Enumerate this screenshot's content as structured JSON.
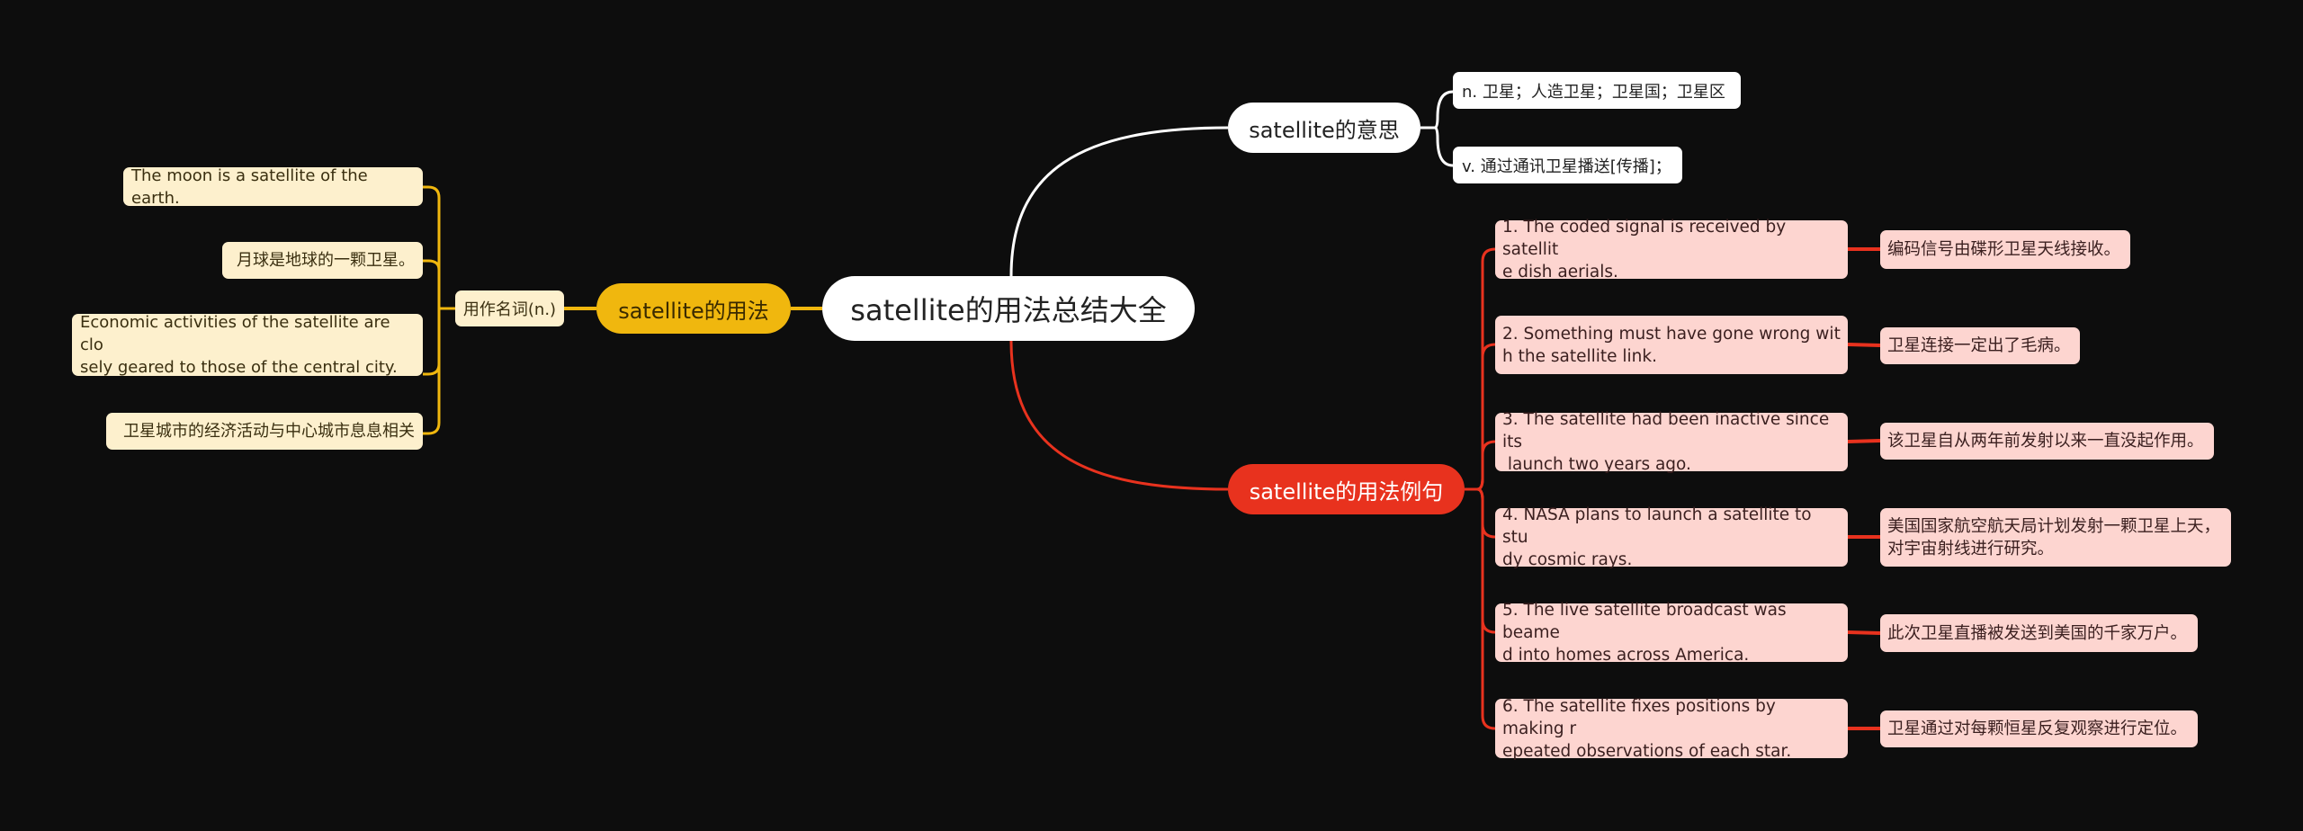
{
  "root": {
    "label": "satellite的用法总结大全"
  },
  "branches": {
    "usage": {
      "label": "satellite的用法",
      "color": "#f0b70e",
      "category": {
        "label": "用作名词(n.)"
      },
      "examples": [
        "The moon is a satellite of the earth.",
        "月球是地球的一颗卫星。",
        "Economic activities of the satellite are clo\nsely geared to those of the central city.",
        "卫星城市的经济活动与中心城市息息相关"
      ]
    },
    "meaning": {
      "label": "satellite的意思",
      "color": "#ffffff",
      "items": [
        "n. 卫星；人造卫星；卫星国；卫星区",
        "v. 通过通讯卫星播送[传播]；"
      ]
    },
    "sentences": {
      "label": "satellite的用法例句",
      "color": "#e8321e",
      "items": [
        {
          "en": "1. The coded signal is received by satellit\ne dish aerials.",
          "zh": "编码信号由碟形卫星天线接收。"
        },
        {
          "en": "2. Something must have gone wrong wit\nh the satellite link.",
          "zh": "卫星连接一定出了毛病。"
        },
        {
          "en": "3. The satellite had been inactive since its\n launch two years ago.",
          "zh": "该卫星自从两年前发射以来一直没起作用。"
        },
        {
          "en": "4. NASA plans to launch a satellite to stu\ndy cosmic rays.",
          "zh": "美国国家航空航天局计划发射一颗卫星上天，\n对宇宙射线进行研究。"
        },
        {
          "en": "5. The live satellite broadcast was beame\nd into homes across America.",
          "zh": "此次卫星直播被发送到美国的千家万户。"
        },
        {
          "en": "6. The satellite fixes positions by making r\nepeated observations of each star.",
          "zh": "卫星通过对每颗恒星反复观察进行定位。"
        }
      ]
    }
  }
}
